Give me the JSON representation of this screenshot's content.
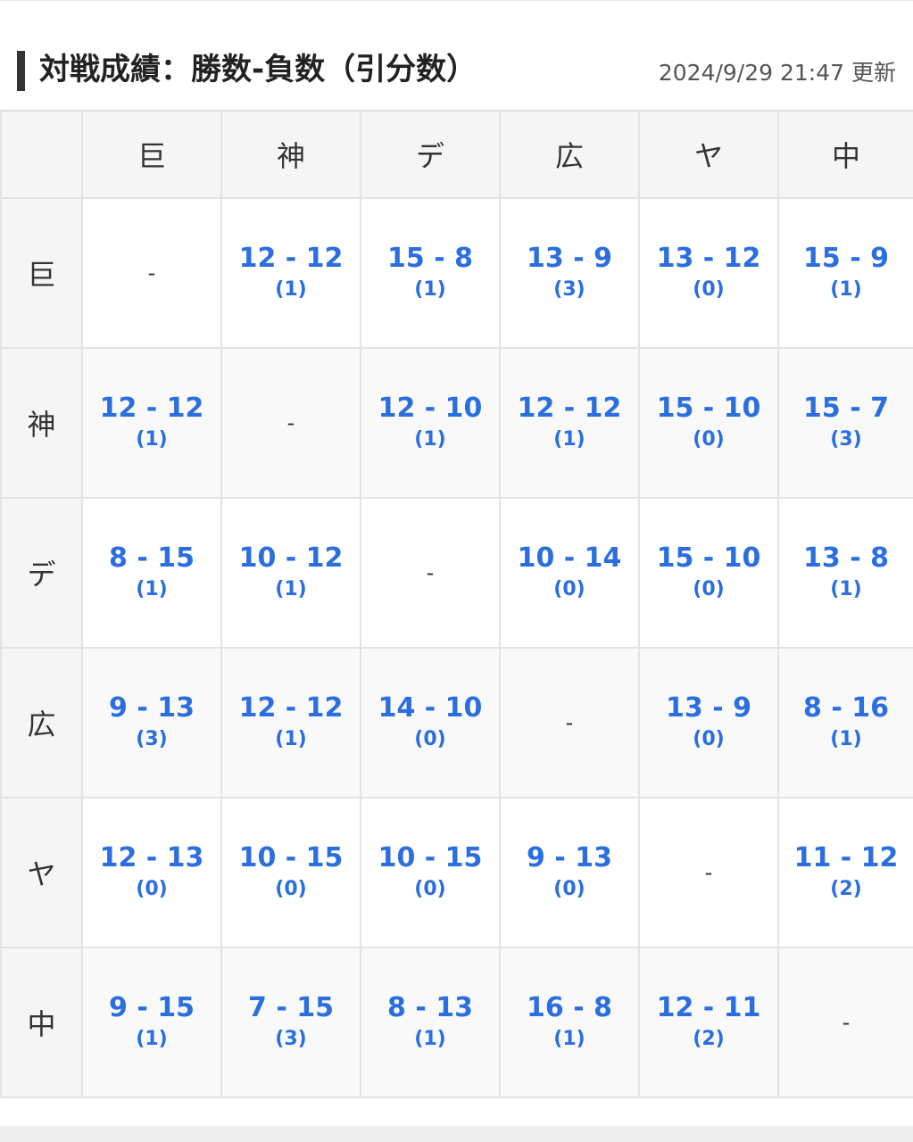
{
  "header": {
    "title": "対戦成績：勝数-負数（引分数）",
    "updated": "2024/9/29 21:47 更新"
  },
  "teams": [
    "巨",
    "神",
    "デ",
    "広",
    "ヤ",
    "中"
  ],
  "dash": "-",
  "rows": [
    {
      "cells": [
        {
          "score": "",
          "draws": ""
        },
        {
          "score": "12 - 12",
          "draws": "(1)"
        },
        {
          "score": "15 - 8",
          "draws": "(1)"
        },
        {
          "score": "13 - 9",
          "draws": "(3)"
        },
        {
          "score": "13 - 12",
          "draws": "(0)"
        },
        {
          "score": "15 - 9",
          "draws": "(1)"
        }
      ]
    },
    {
      "cells": [
        {
          "score": "12 - 12",
          "draws": "(1)"
        },
        {
          "score": "",
          "draws": ""
        },
        {
          "score": "12 - 10",
          "draws": "(1)"
        },
        {
          "score": "12 - 12",
          "draws": "(1)"
        },
        {
          "score": "15 - 10",
          "draws": "(0)"
        },
        {
          "score": "15 - 7",
          "draws": "(3)"
        }
      ]
    },
    {
      "cells": [
        {
          "score": "8 - 15",
          "draws": "(1)"
        },
        {
          "score": "10 - 12",
          "draws": "(1)"
        },
        {
          "score": "",
          "draws": ""
        },
        {
          "score": "10 - 14",
          "draws": "(0)"
        },
        {
          "score": "15 - 10",
          "draws": "(0)"
        },
        {
          "score": "13 - 8",
          "draws": "(1)"
        }
      ]
    },
    {
      "cells": [
        {
          "score": "9 - 13",
          "draws": "(3)"
        },
        {
          "score": "12 - 12",
          "draws": "(1)"
        },
        {
          "score": "14 - 10",
          "draws": "(0)"
        },
        {
          "score": "",
          "draws": ""
        },
        {
          "score": "13 - 9",
          "draws": "(0)"
        },
        {
          "score": "8 - 16",
          "draws": "(1)"
        }
      ]
    },
    {
      "cells": [
        {
          "score": "12 - 13",
          "draws": "(0)"
        },
        {
          "score": "10 - 15",
          "draws": "(0)"
        },
        {
          "score": "10 - 15",
          "draws": "(0)"
        },
        {
          "score": "9 - 13",
          "draws": "(0)"
        },
        {
          "score": "",
          "draws": ""
        },
        {
          "score": "11 - 12",
          "draws": "(2)"
        }
      ]
    },
    {
      "cells": [
        {
          "score": "9 - 15",
          "draws": "(1)"
        },
        {
          "score": "7 - 15",
          "draws": "(3)"
        },
        {
          "score": "8 - 13",
          "draws": "(1)"
        },
        {
          "score": "16 - 8",
          "draws": "(1)"
        },
        {
          "score": "12 - 11",
          "draws": "(2)"
        },
        {
          "score": "",
          "draws": ""
        }
      ]
    }
  ],
  "colors": {
    "score_blue": "#2a6ee0",
    "header_bg": "#f5f5f5",
    "border": "#e3e3e3",
    "title_bar": "#333333"
  }
}
